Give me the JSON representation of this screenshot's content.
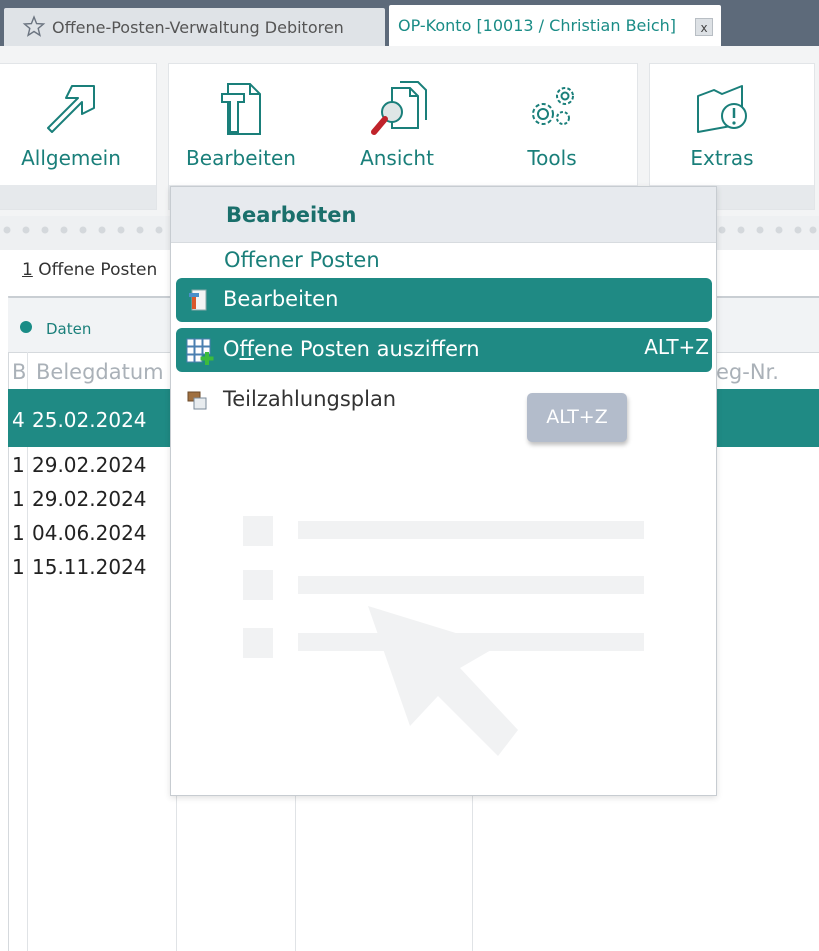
{
  "tabs": [
    {
      "label": "Offene-Posten-Verwaltung Debitoren",
      "active": false
    },
    {
      "label": "OP-Konto [10013 / Christian Beich]",
      "active": true,
      "close_label": "x"
    }
  ],
  "ribbon": {
    "buttons": [
      {
        "label": "Allgemein",
        "icon": "arrow-up-right-icon"
      },
      {
        "label": "Bearbeiten",
        "icon": "document-edit-icon"
      },
      {
        "label": "Ansicht",
        "icon": "magnifier-document-icon"
      },
      {
        "label": "Tools",
        "icon": "gears-icon"
      },
      {
        "label": "Extras",
        "icon": "folder-alert-icon"
      }
    ]
  },
  "subtab": {
    "number": "1",
    "label": "Offene Posten"
  },
  "grid": {
    "group_label": "Daten",
    "columns": [
      "B",
      "Belegdatum",
      "eg-Nr."
    ],
    "rows": [
      {
        "b": "4",
        "date": "25.02.2024",
        "selected": true
      },
      {
        "b": "1",
        "date": "29.02.2024",
        "selected": false
      },
      {
        "b": "1",
        "date": "29.02.2024",
        "selected": false
      },
      {
        "b": "1",
        "date": "04.06.2024",
        "selected": false
      },
      {
        "b": "1",
        "date": "15.11.2024",
        "selected": false
      }
    ]
  },
  "dropdown": {
    "title": "Bearbeiten",
    "section": "Offener Posten",
    "items": [
      {
        "label": "Bearbeiten",
        "shortcut": "",
        "icon": "edit-document-icon",
        "active": true
      },
      {
        "label_pre": "O",
        "label_ul": "ff",
        "label_post": "ene Posten ausziffern",
        "shortcut": "ALT+Z",
        "icon": "grid-add-icon",
        "active": true
      },
      {
        "label": "Teilzahlungsplan",
        "shortcut": "",
        "icon": "installment-plan-icon",
        "active": false
      }
    ],
    "tooltip": "ALT+Z"
  },
  "colors": {
    "accent": "#1f8a84",
    "tabbar": "#5d6a7a"
  }
}
